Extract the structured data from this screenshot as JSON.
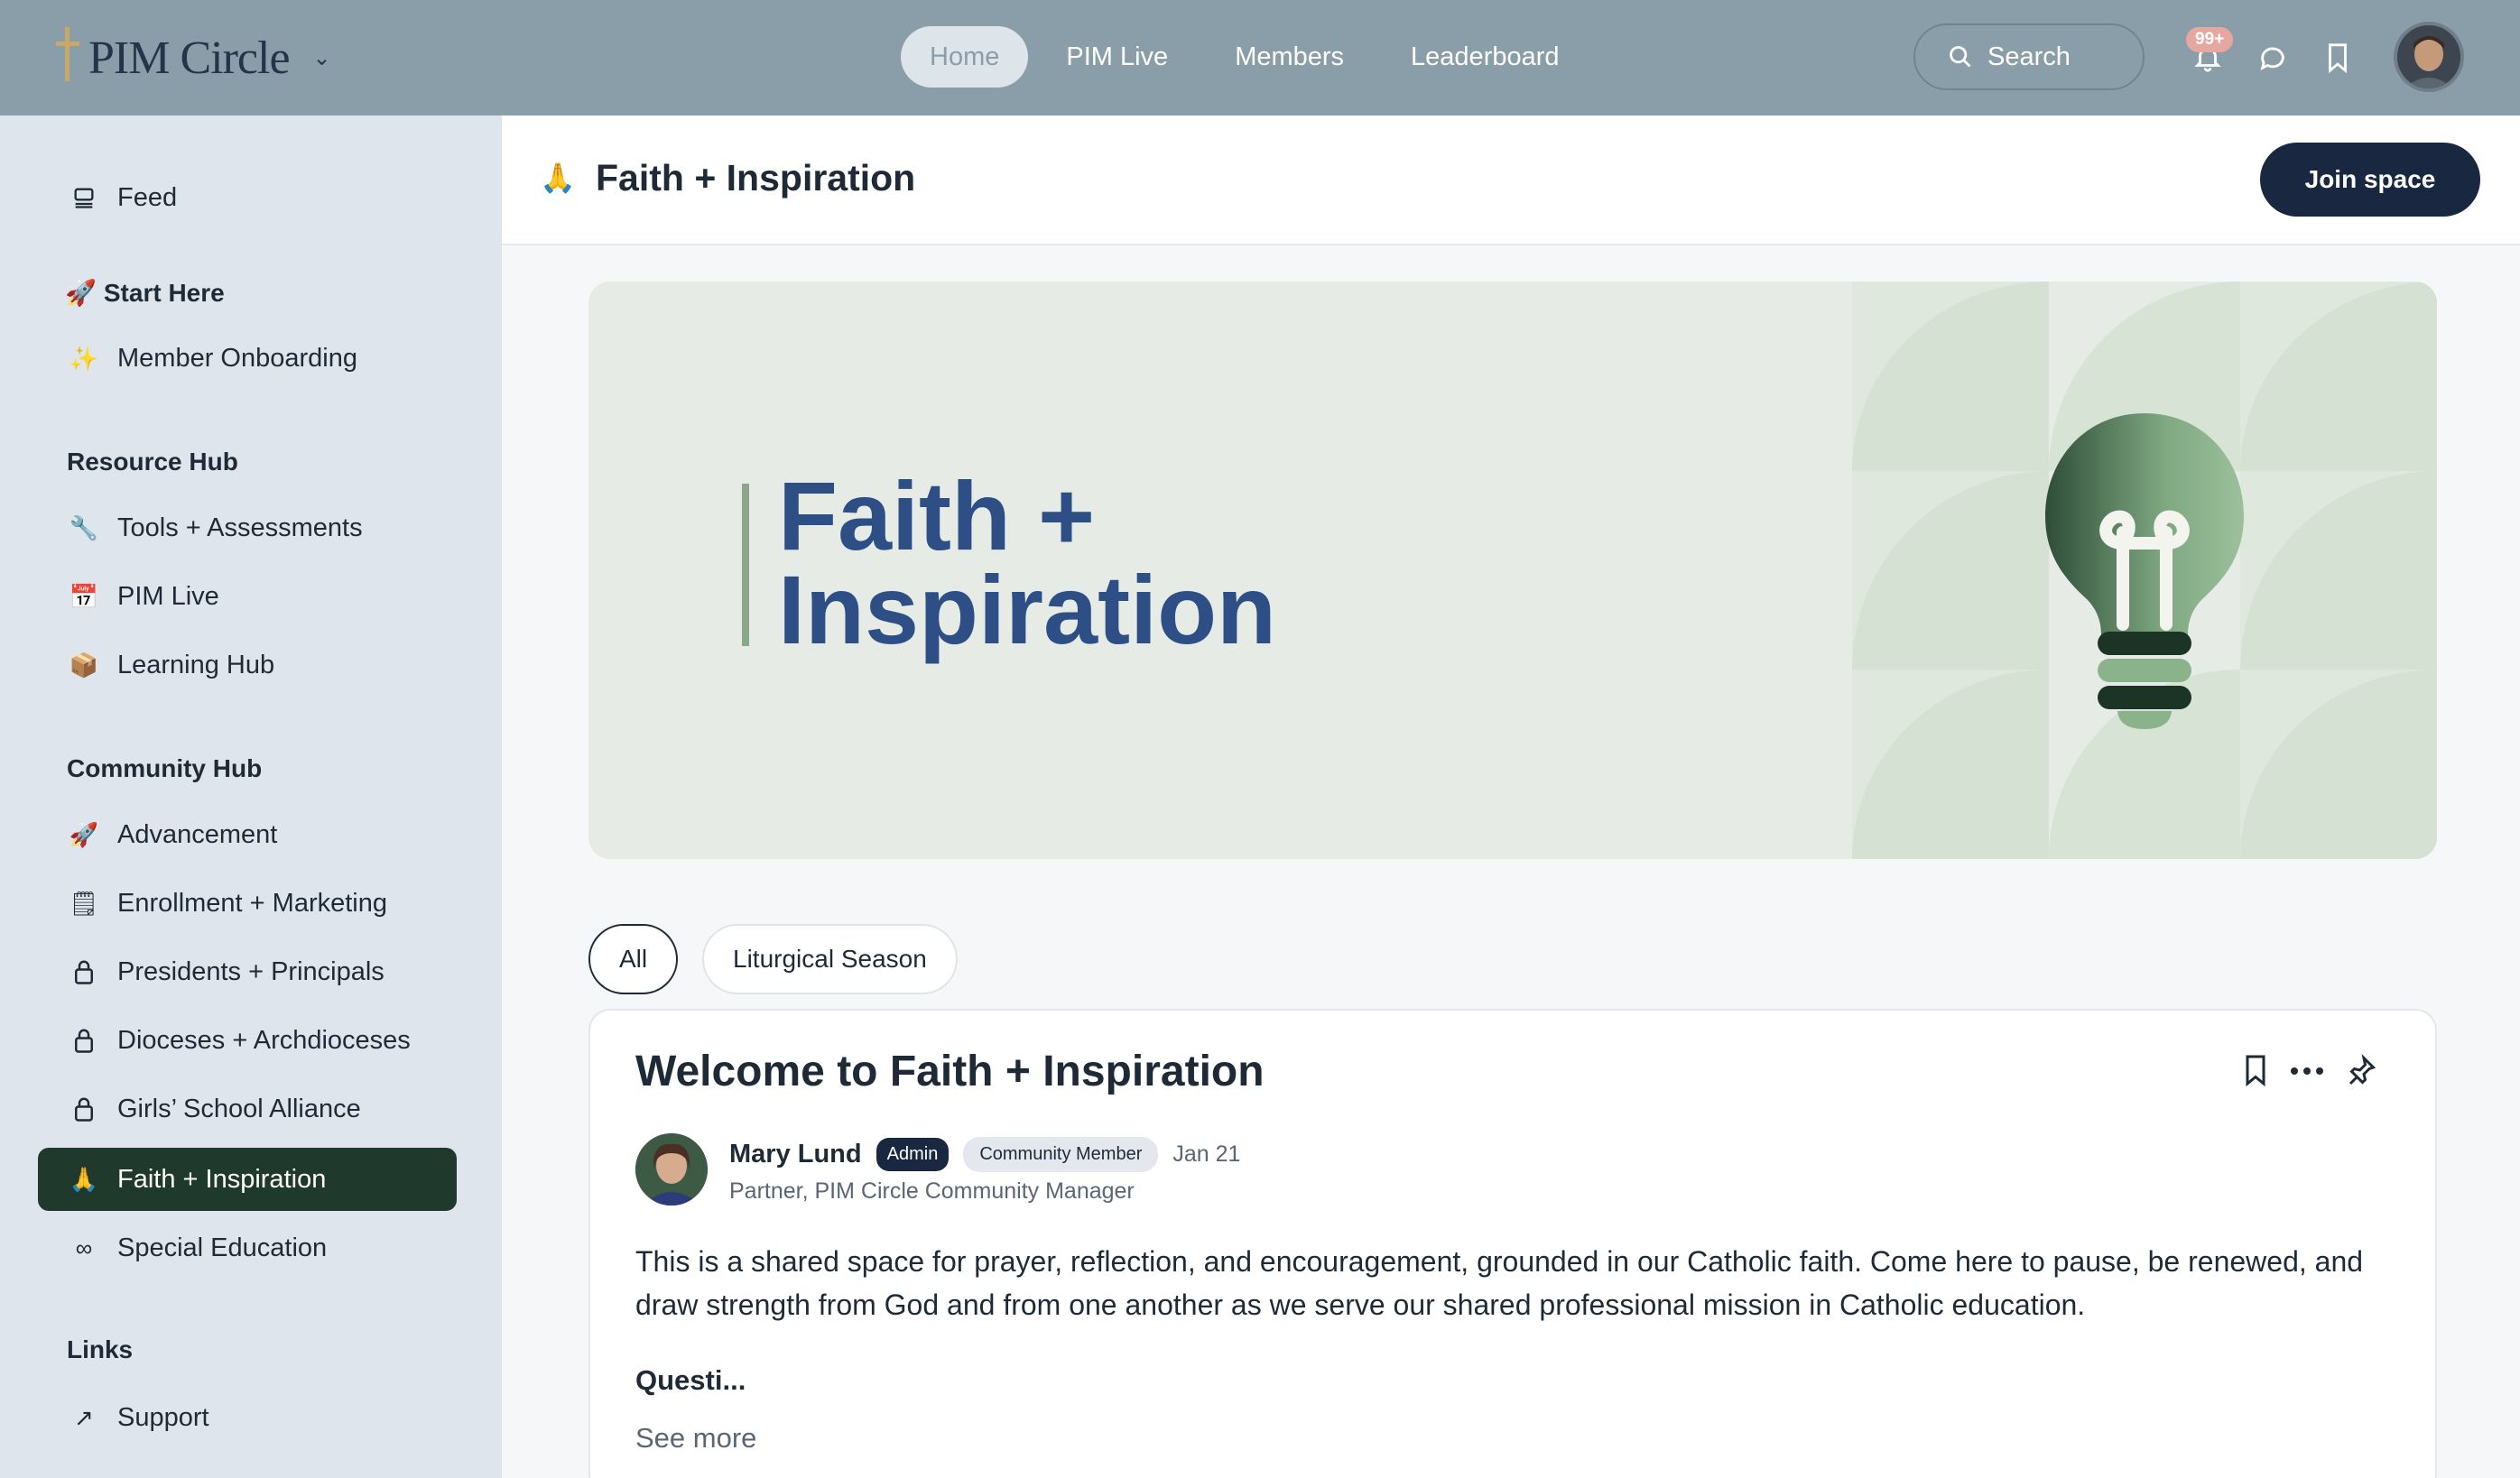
{
  "brand": {
    "name": "PIM Circle"
  },
  "nav": {
    "items": [
      {
        "label": "Home"
      },
      {
        "label": "PIM Live"
      },
      {
        "label": "Members"
      },
      {
        "label": "Leaderboard"
      }
    ],
    "search_label": "Search",
    "notification_count": "99+"
  },
  "sidebar": {
    "feed": "Feed",
    "start_here": {
      "title": "Start Here",
      "items": [
        {
          "label": "Member Onboarding"
        }
      ]
    },
    "resource_hub": {
      "title": "Resource Hub",
      "items": [
        {
          "label": "Tools + Assessments"
        },
        {
          "label": "PIM Live"
        },
        {
          "label": "Learning Hub"
        }
      ]
    },
    "community_hub": {
      "title": "Community Hub",
      "items": [
        {
          "label": "Advancement"
        },
        {
          "label": "Enrollment + Marketing"
        },
        {
          "label": "Presidents + Principals"
        },
        {
          "label": "Dioceses + Archdioceses"
        },
        {
          "label": "Girls’ School Alliance"
        },
        {
          "label": "Faith + Inspiration"
        },
        {
          "label": "Special Education"
        }
      ]
    },
    "links": {
      "title": "Links",
      "items": [
        {
          "label": "Support"
        }
      ]
    }
  },
  "space": {
    "title": "Faith + Inspiration",
    "join_label": "Join space",
    "banner_line1": "Faith +",
    "banner_line2": "Inspiration"
  },
  "tabs": [
    {
      "label": "All"
    },
    {
      "label": "Liturgical Season"
    }
  ],
  "post": {
    "title": "Welcome to Faith + Inspiration",
    "author": "Mary Lund",
    "admin_tag": "Admin",
    "member_tag": "Community Member",
    "date": "Jan 21",
    "author_title": "Partner, PIM Circle Community Manager",
    "body": "This is a shared space for prayer, reflection, and encouragement, grounded in our Catholic faith. Come here to pause, be renewed, and draw strength from God and from one another as we serve our shared professional mission in Catholic education.",
    "subheading": "Questi...",
    "see_more": "See more"
  },
  "colors": {
    "topbar": "#8a9ea9",
    "sidebar": "#dfe5ec",
    "active_item": "#1f3a2c",
    "primary_button": "#1a2740",
    "banner_title": "#2d4f86",
    "banner_bg": "#e6ece5"
  }
}
